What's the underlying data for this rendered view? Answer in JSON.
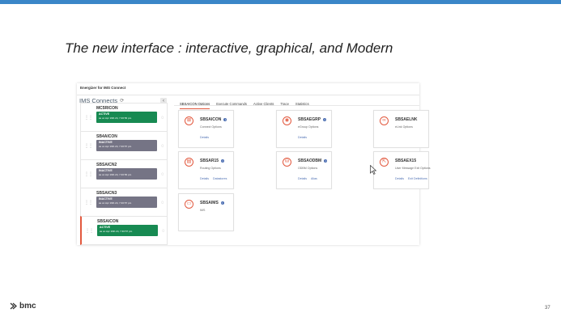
{
  "slide": {
    "title": "The new interface : interactive, graphical, and Modern",
    "page_number": "37",
    "logo_text": "bmc"
  },
  "app": {
    "window_tab": "Energizer for IMS Connect",
    "sidebar_title": "IMS Connects",
    "connections": [
      {
        "name": "MC5RICON",
        "status": "ACTIVE",
        "time": "as on Apr 19th 24, 7:46:56 pm",
        "state": "active"
      },
      {
        "name": "SB4AICON",
        "status": "INACTIVE",
        "time": "as on Apr 19th 24, 7:46:57 pm",
        "state": "inactive"
      },
      {
        "name": "SBSAICN2",
        "status": "INACTIVE",
        "time": "as on Apr 19th 24, 7:46:56 pm",
        "state": "inactive"
      },
      {
        "name": "SBSAICN3",
        "status": "INACTIVE",
        "time": "as on Apr 19th 24, 7:46:57 pm",
        "state": "inactive"
      },
      {
        "name": "SBSAICON",
        "status": "ACTIVE",
        "time": "as on Apr 19th 24, 7:46:57 pm",
        "state": "active"
      }
    ],
    "tabs": [
      "SBSAICON Options",
      "Execute Commands",
      "Active Clients",
      "Trace",
      "Statistics"
    ],
    "cards": [
      {
        "title": "SBSAICON",
        "desc": "Connect Options",
        "links": [
          "Details"
        ]
      },
      {
        "title": "SBSAEGRP",
        "desc": "eGroup Options",
        "links": [
          "Details"
        ]
      },
      {
        "title": "SBSAELNK",
        "desc": "eLink Options",
        "links": []
      },
      {
        "title": "SBSAR15",
        "desc": "Routing Options",
        "links": [
          "Details",
          "Datastores"
        ]
      },
      {
        "title": "SBSAODBM",
        "desc": "ODBM Options",
        "links": [
          "Details",
          "Alias"
        ]
      },
      {
        "title": "SBSAEX15",
        "desc": "User Message Exit Options",
        "links": [
          "Details",
          "Exit Definitions"
        ]
      },
      {
        "title": "SBSAIMS",
        "desc": "IMS",
        "links": []
      }
    ]
  }
}
